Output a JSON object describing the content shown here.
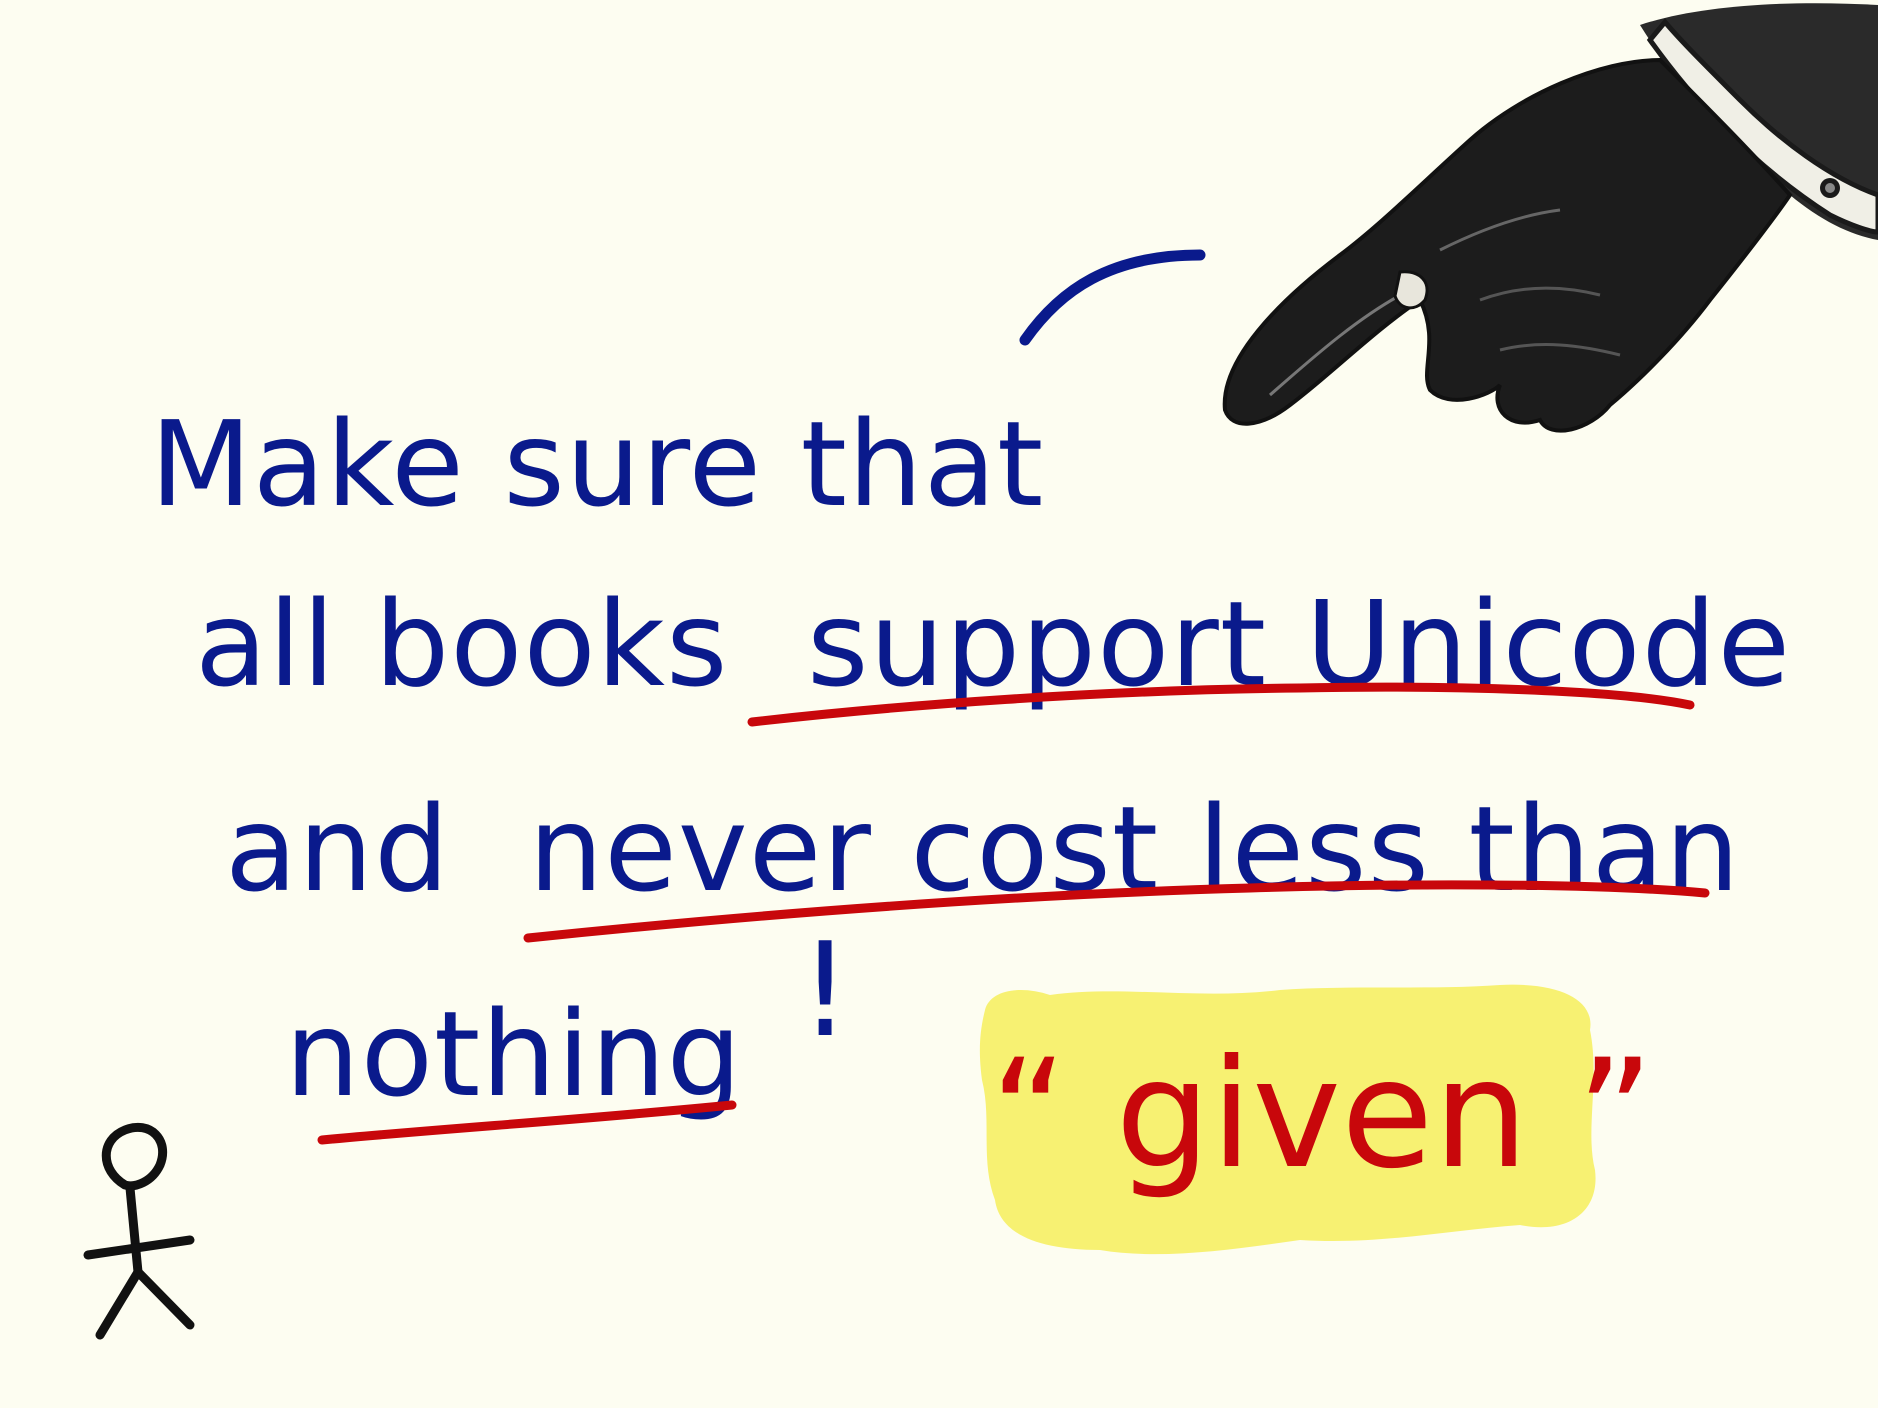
{
  "message": {
    "line1": "Make sure that",
    "line2_a": "all books",
    "line2_b": "support Unicode",
    "line3_a": "and",
    "line3_b": "never cost less than",
    "line4_a": "nothing",
    "line4_b": "!"
  },
  "callout": {
    "text": "“ given ”"
  },
  "colors": {
    "background": "#fdfdf1",
    "text_blue": "#0a1a8c",
    "underline_red": "#c8070b",
    "highlight_yellow": "#f7f06a",
    "stick_figure": "#111111"
  },
  "icons": {
    "hand": "pointing-hand-icon",
    "figure": "stick-figure-icon"
  }
}
